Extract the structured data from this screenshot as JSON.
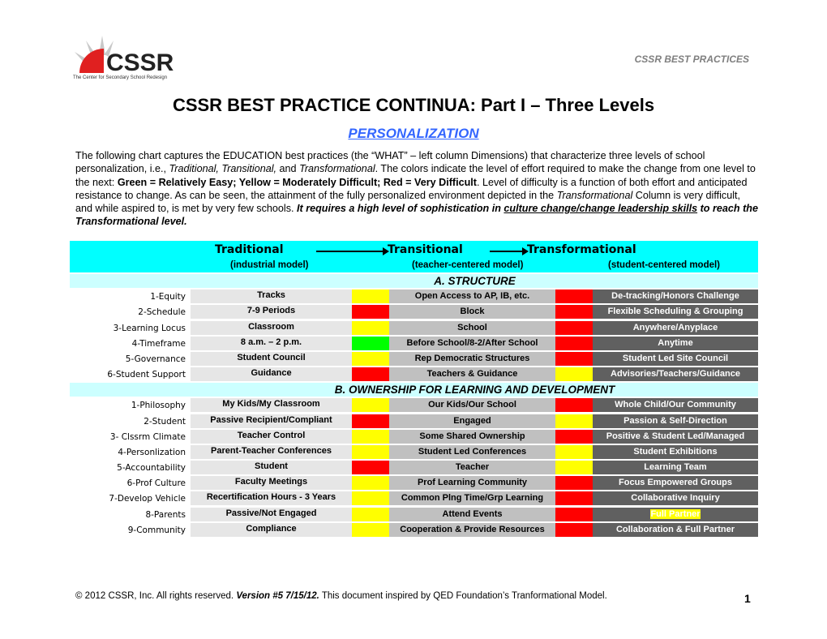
{
  "header": {
    "logo_text": "CSSR",
    "logo_tagline": "The Center for Secondary School Redesign",
    "running_title": "CSSR BEST PRACTICES"
  },
  "title": "CSSR BEST PRACTICE CONTINUA: Part I – Three Levels",
  "subtitle": "PERSONALIZATION",
  "intro": {
    "p1": "The following chart captures the EDUCATION best practices (the “WHAT” – left column Dimensions) that characterize three levels of school personalization, i.e., ",
    "i1": "Traditional, Transitional,",
    "p2": " and ",
    "i2": "Transformational",
    "p3": ".  The colors indicate the level of effort required to make the change from one level to the next: ",
    "b1": "Green = Relatively Easy; Yellow = Moderately Difficult; Red = Very Difficult",
    "p4": ".  Level of difficulty is a function of both effort and anticipated resistance to change.  As can be seen, the attainment of the fully personalized environment depicted in the ",
    "i3": "Transformational",
    "p5": " Column is very difficult, and while aspired to, is met by very few schools.  ",
    "bi1": "It requires a high level of sophistication in ",
    "bi_u": "culture change/change leadership skills",
    "bi2": " to reach the Transformational level."
  },
  "levels": [
    {
      "name": "Traditional",
      "model": "(industrial model)"
    },
    {
      "name": "Transitional",
      "model": "(teacher-centered model)"
    },
    {
      "name": "Transformational",
      "model": "(student-centered model)"
    }
  ],
  "difficulty_colors": {
    "green": "#00ff00",
    "yellow": "#ffff00",
    "red": "#ff0000"
  },
  "sections": [
    {
      "title": "A. STRUCTURE",
      "rows": [
        {
          "dimension": "1-Equity",
          "traditional": "Tracks",
          "c1": "yellow",
          "transitional": "Open Access to AP, IB, etc.",
          "c2": "red",
          "transformational": "De-tracking/Honors Challenge"
        },
        {
          "dimension": "2-Schedule",
          "traditional": "7-9 Periods",
          "c1": "red",
          "transitional": "Block",
          "c2": "red",
          "transformational": "Flexible Scheduling & Grouping"
        },
        {
          "dimension": "3-Learning Locus",
          "traditional": "Classroom",
          "c1": "yellow",
          "transitional": "School",
          "c2": "red",
          "transformational": "Anywhere/Anyplace"
        },
        {
          "dimension": "4-Timeframe",
          "traditional": "8 a.m. – 2 p.m.",
          "c1": "green",
          "transitional": "Before School/8-2/After School",
          "c2": "red",
          "transformational": "Anytime"
        },
        {
          "dimension": "5-Governance",
          "traditional": "Student Council",
          "c1": "yellow",
          "transitional": "Rep Democratic Structures",
          "c2": "red",
          "transformational": "Student Led Site Council"
        },
        {
          "dimension": "6-Student Support",
          "traditional": "Guidance",
          "c1": "red",
          "transitional": "Teachers & Guidance",
          "c2": "yellow",
          "transformational": "Advisories/Teachers/Guidance"
        }
      ]
    },
    {
      "title": "B. OWNERSHIP FOR LEARNING AND DEVELOPMENT",
      "rows": [
        {
          "dimension": "1-Philosophy",
          "traditional": "My Kids/My Classroom",
          "c1": "yellow",
          "transitional": "Our Kids/Our School",
          "c2": "red",
          "transformational": "Whole Child/Our Community"
        },
        {
          "dimension": "2-Student",
          "traditional": "Passive Recipient/Compliant",
          "c1": "red",
          "transitional": "Engaged",
          "c2": "yellow",
          "transformational": "Passion & Self-Direction"
        },
        {
          "dimension": "3- Clssrm Climate",
          "traditional": "Teacher Control",
          "c1": "yellow",
          "transitional": "Some Shared Ownership",
          "c2": "red",
          "transformational": "Positive & Student Led/Managed"
        },
        {
          "dimension": "4-Personlization",
          "traditional": "Parent-Teacher Conferences",
          "c1": "yellow",
          "transitional": "Student Led Conferences",
          "c2": "yellow",
          "transformational": "Student Exhibitions"
        },
        {
          "dimension": "5-Accountability",
          "traditional": "Student",
          "c1": "red",
          "transitional": "Teacher",
          "c2": "yellow",
          "transformational": "Learning Team"
        },
        {
          "dimension": "6-Prof Culture",
          "traditional": "Faculty Meetings",
          "c1": "yellow",
          "transitional": "Prof Learning Community",
          "c2": "red",
          "transformational": "Focus Empowered Groups"
        },
        {
          "dimension": "7-Develop Vehicle",
          "traditional": "Recertification Hours - 3 Years",
          "c1": "yellow",
          "transitional": "Common Plng Time/Grp Learning",
          "c2": "red",
          "transformational": "Collaborative Inquiry"
        },
        {
          "dimension": "8-Parents",
          "traditional": "Passive/Not Engaged",
          "c1": "yellow",
          "transitional": "Attend Events",
          "c2": "red",
          "transformational": "Full Partner",
          "highlight": true
        },
        {
          "dimension": "9-Community",
          "traditional": "Compliance",
          "c1": "yellow",
          "transitional": "Cooperation & Provide Resources",
          "c2": "red",
          "transformational": "Collaboration & Full Partner"
        }
      ]
    }
  ],
  "footer": {
    "copyright": "© 2012 CSSR, Inc.  All rights reserved.  ",
    "version": "Version #5 7/15/12.",
    "note": "  This document inspired by QED Foundation’s Tranformational Model.",
    "page_number": "1"
  }
}
